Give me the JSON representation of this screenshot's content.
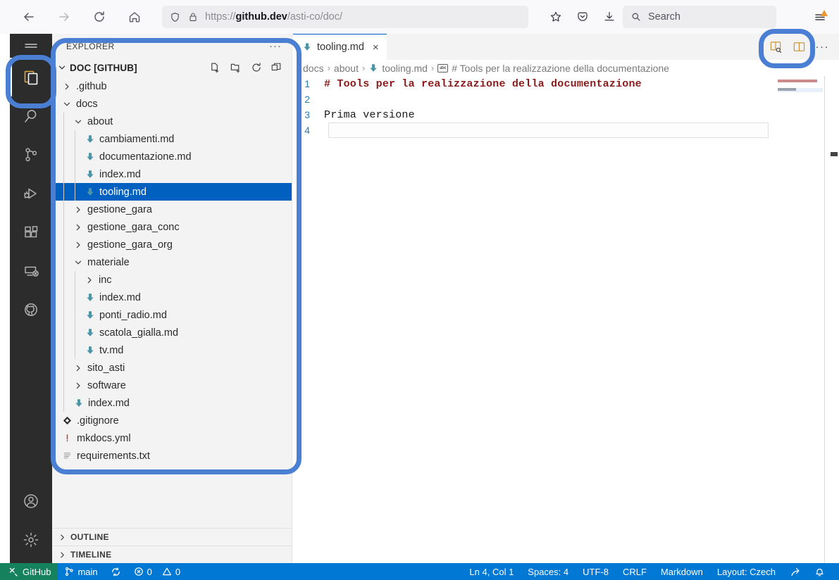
{
  "browser": {
    "back_label": "Back",
    "forward_label": "Forward",
    "reload_label": "Reload",
    "home_label": "Home",
    "url_prefix": "https://",
    "url_domain": "github.dev",
    "url_path": "/asti-co/doc/",
    "search_placeholder": "Search",
    "bookmark_label": "Bookmark this page",
    "pocket_label": "Save to Pocket",
    "downloads_label": "Downloads",
    "menu_label": "Open application menu"
  },
  "activitybar": {
    "menu_label": "Menu",
    "items": [
      {
        "name": "explorer",
        "label": "Explorer",
        "active": true
      },
      {
        "name": "search",
        "label": "Search",
        "active": false
      },
      {
        "name": "source-control",
        "label": "Source Control",
        "active": false
      },
      {
        "name": "run-debug",
        "label": "Run and Debug",
        "active": false
      },
      {
        "name": "extensions",
        "label": "Extensions",
        "active": false
      },
      {
        "name": "remote-explorer",
        "label": "Remote Explorer",
        "active": false
      },
      {
        "name": "github",
        "label": "GitHub",
        "active": false
      }
    ],
    "bottom": [
      {
        "name": "accounts",
        "label": "Accounts"
      },
      {
        "name": "settings",
        "label": "Manage"
      }
    ]
  },
  "sidebar": {
    "title": "EXPLORER",
    "more_label": "···",
    "root_label": "DOC [GITHUB]",
    "root_actions": [
      {
        "name": "new-file",
        "label": "New File..."
      },
      {
        "name": "new-folder",
        "label": "New Folder..."
      },
      {
        "name": "refresh-explorer",
        "label": "Refresh Explorer"
      },
      {
        "name": "collapse-folders",
        "label": "Collapse Folders in Explorer"
      }
    ],
    "tree": [
      {
        "label": ".github",
        "type": "folder",
        "indent": 0,
        "expanded": false,
        "selected": false
      },
      {
        "label": "docs",
        "type": "folder",
        "indent": 0,
        "expanded": true,
        "selected": false
      },
      {
        "label": "about",
        "type": "folder",
        "indent": 1,
        "expanded": true,
        "selected": false
      },
      {
        "label": "cambiamenti.md",
        "type": "md",
        "indent": 2,
        "selected": false
      },
      {
        "label": "documentazione.md",
        "type": "md",
        "indent": 2,
        "selected": false
      },
      {
        "label": "index.md",
        "type": "md",
        "indent": 2,
        "selected": false
      },
      {
        "label": "tooling.md",
        "type": "md",
        "indent": 2,
        "selected": true
      },
      {
        "label": "gestione_gara",
        "type": "folder",
        "indent": 1,
        "expanded": false,
        "selected": false
      },
      {
        "label": "gestione_gara_conc",
        "type": "folder",
        "indent": 1,
        "expanded": false,
        "selected": false
      },
      {
        "label": "gestione_gara_org",
        "type": "folder",
        "indent": 1,
        "expanded": false,
        "selected": false
      },
      {
        "label": "materiale",
        "type": "folder",
        "indent": 1,
        "expanded": true,
        "selected": false
      },
      {
        "label": "inc",
        "type": "folder",
        "indent": 2,
        "expanded": false,
        "selected": false
      },
      {
        "label": "index.md",
        "type": "md",
        "indent": 2,
        "selected": false
      },
      {
        "label": "ponti_radio.md",
        "type": "md",
        "indent": 2,
        "selected": false
      },
      {
        "label": "scatola_gialla.md",
        "type": "md",
        "indent": 2,
        "selected": false
      },
      {
        "label": "tv.md",
        "type": "md",
        "indent": 2,
        "selected": false
      },
      {
        "label": "sito_asti",
        "type": "folder",
        "indent": 1,
        "expanded": false,
        "selected": false
      },
      {
        "label": "software",
        "type": "folder",
        "indent": 1,
        "expanded": false,
        "selected": false
      },
      {
        "label": "index.md",
        "type": "md",
        "indent": 1,
        "selected": false
      },
      {
        "label": ".gitignore",
        "type": "git",
        "indent": 0,
        "selected": false
      },
      {
        "label": "mkdocs.yml",
        "type": "yml",
        "indent": 0,
        "selected": false
      },
      {
        "label": "requirements.txt",
        "type": "txt",
        "indent": 0,
        "selected": false
      }
    ],
    "panels": [
      {
        "name": "outline",
        "label": "OUTLINE"
      },
      {
        "name": "timeline",
        "label": "TIMELINE"
      }
    ]
  },
  "editor": {
    "tab": {
      "label": "tooling.md",
      "close_label": "×"
    },
    "actions": [
      {
        "name": "open-preview-to-side",
        "label": "Open Preview to the Side"
      },
      {
        "name": "split-editor",
        "label": "Split Editor Right"
      }
    ],
    "more_label": "···",
    "breadcrumb": [
      {
        "label": "docs",
        "icon": "none"
      },
      {
        "label": "about",
        "icon": "none"
      },
      {
        "label": "tooling.md",
        "icon": "md"
      },
      {
        "label": "# Tools per la realizzazione della documentazione",
        "icon": "symbol-string"
      }
    ],
    "lines": [
      {
        "num": "1",
        "text": "# Tools per la realizzazione della documentazione",
        "style": "heading"
      },
      {
        "num": "2",
        "text": "",
        "style": "plain"
      },
      {
        "num": "3",
        "text": "Prima versione",
        "style": "plain"
      },
      {
        "num": "4",
        "text": "",
        "style": "current"
      }
    ]
  },
  "statusbar": {
    "remote": "GitHub",
    "branch": "main",
    "sync_label": "Synchronize Changes",
    "errors": "0",
    "warnings": "0",
    "position": "Ln 4, Col 1",
    "indent": "Spaces: 4",
    "encoding": "UTF-8",
    "eol": "CRLF",
    "language": "Markdown",
    "keyboard_layout": "Layout: Czech",
    "feedback_label": "Tweet Feedback",
    "bell_label": "No Notifications"
  },
  "annotations": {
    "highlight_color": "#4a7fd4",
    "regions": [
      {
        "name": "explorer-activity-icon-highlight"
      },
      {
        "name": "explorer-panel-highlight"
      },
      {
        "name": "editor-actions-highlight"
      }
    ]
  }
}
